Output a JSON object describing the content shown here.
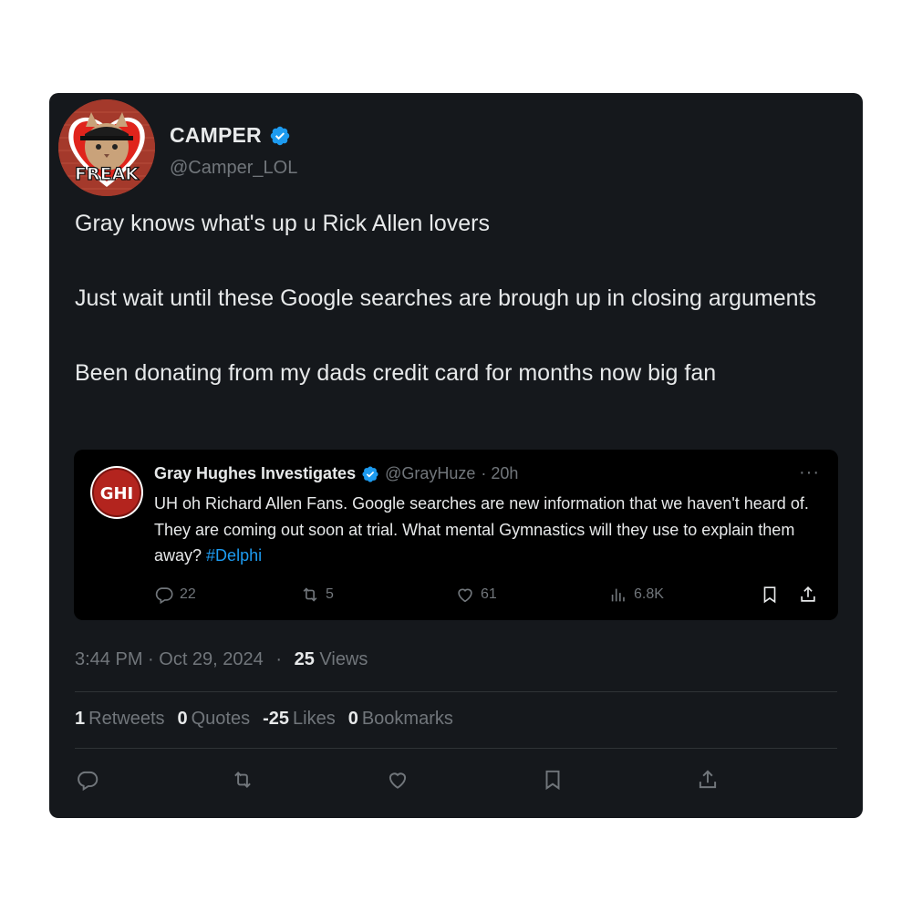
{
  "tweet": {
    "display_name": "CAMPER",
    "handle": "@Camper_LOL",
    "avatar_label": "FREAK",
    "lines": [
      "Gray knows what's up u Rick Allen lovers",
      "Just wait until these Google searches are brough up in closing arguments",
      "Been donating from my dads credit card for months now big fan"
    ],
    "timestamp": "3:44 PM · Oct 29, 2024",
    "separator": "·",
    "views_count": "25",
    "views_label": "Views"
  },
  "quote": {
    "avatar_label": "GHI",
    "display_name": "Gray Hughes Investigates",
    "handle": "@GrayHuze",
    "time": "· 20h",
    "more": "···",
    "text": "UH oh Richard Allen Fans.  Google searches are new information that we haven't heard of.   They are coming out soon at trial.  What mental Gymnastics will they use to explain them away? ",
    "hashtag": "#Delphi",
    "replies": "22",
    "retweets": "5",
    "likes": "61",
    "views": "6.8K"
  },
  "stats": {
    "retweets_count": "1",
    "retweets_label": "Retweets",
    "quotes_count": "0",
    "quotes_label": "Quotes",
    "likes_count": "-25",
    "likes_label": "Likes",
    "bookmarks_count": "0",
    "bookmarks_label": "Bookmarks"
  },
  "icons": {
    "reply": "reply-icon",
    "retweet": "retweet-icon",
    "like": "heart-icon",
    "bookmark": "bookmark-icon",
    "share": "share-icon",
    "views": "views-icon",
    "verified": "verified-badge-icon"
  },
  "colors": {
    "card_bg": "#15181c",
    "quote_bg": "#000000",
    "text": "#e7e9ea",
    "muted": "#71767b",
    "accent": "#1d9bf0",
    "divider": "#2f3336"
  }
}
